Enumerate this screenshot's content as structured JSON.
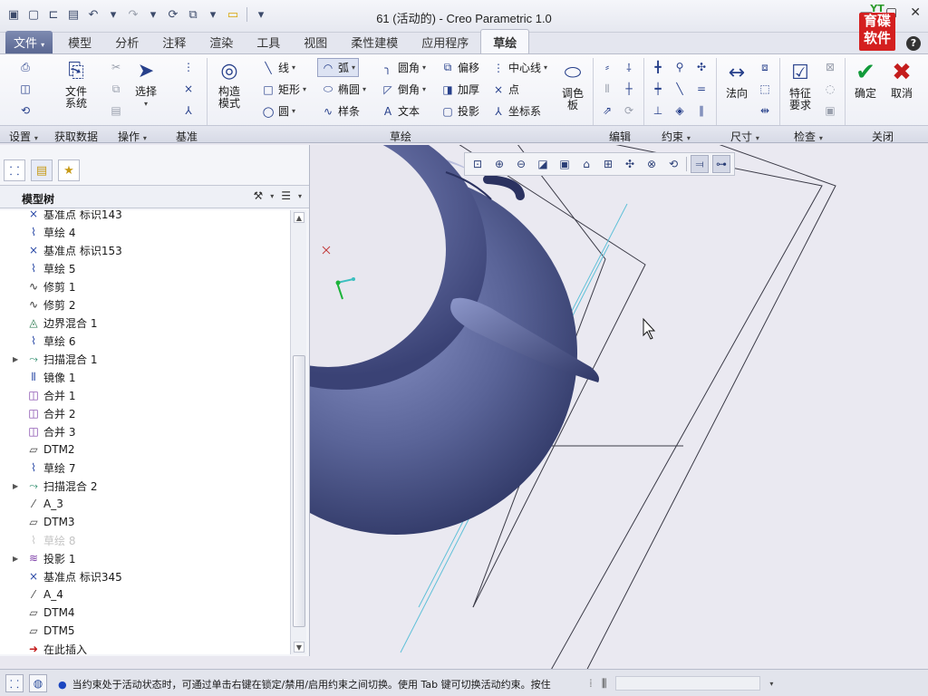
{
  "window": {
    "title": "61 (活动的) - Creo Parametric 1.0"
  },
  "logo": {
    "top": "YT",
    "text": "育碟软件"
  },
  "tabs": [
    "文件",
    "模型",
    "分析",
    "注释",
    "渲染",
    "工具",
    "视图",
    "柔性建模",
    "应用程序",
    "草绘"
  ],
  "active_tab": "草绘",
  "help_label": "?",
  "ribbon": {
    "file_system": "文件\n系统",
    "select": "选择",
    "construct_mode": "构造\n模式",
    "line": "线",
    "arc": "弧",
    "fillet": "圆角",
    "offset": "偏移",
    "centerline": "中心线",
    "rectangle": "矩形",
    "ellipse": "椭圆",
    "chamfer": "倒角",
    "thicken": "加厚",
    "point": "点",
    "circle": "圆",
    "spline": "样条",
    "text": "文本",
    "project": "投影",
    "coord_sys": "坐标系",
    "palette": "调色\n板",
    "normal": "法向",
    "feature_req": "特征\n要求",
    "ok": "确定",
    "cancel": "取消"
  },
  "groups": {
    "setup": "设置",
    "get_data": "获取数据",
    "operations": "操作",
    "datum": "基准",
    "sketch": "草绘",
    "edit": "编辑",
    "constrain": "约束",
    "dimension": "尺寸",
    "inspect": "检查",
    "close": "关闭"
  },
  "model_tree": {
    "title": "模型树",
    "items": [
      {
        "label": "基准点 标识143",
        "icon": "datum-point-icon",
        "expandable": false,
        "dim": false
      },
      {
        "label": "草绘 4",
        "icon": "sketch-icon",
        "expandable": false,
        "dim": false
      },
      {
        "label": "基准点 标识153",
        "icon": "datum-point-icon",
        "expandable": false,
        "dim": false
      },
      {
        "label": "草绘 5",
        "icon": "sketch-icon",
        "expandable": false,
        "dim": false
      },
      {
        "label": "修剪 1",
        "icon": "trim-icon",
        "expandable": false,
        "dim": false
      },
      {
        "label": "修剪 2",
        "icon": "trim-icon",
        "expandable": false,
        "dim": false
      },
      {
        "label": "边界混合 1",
        "icon": "boundary-blend-icon",
        "expandable": false,
        "dim": false
      },
      {
        "label": "草绘 6",
        "icon": "sketch-icon",
        "expandable": false,
        "dim": false
      },
      {
        "label": "扫描混合 1",
        "icon": "swept-blend-icon",
        "expandable": true,
        "dim": false
      },
      {
        "label": "镜像 1",
        "icon": "mirror-icon",
        "expandable": false,
        "dim": false
      },
      {
        "label": "合并 1",
        "icon": "merge-icon",
        "expandable": false,
        "dim": false
      },
      {
        "label": "合并 2",
        "icon": "merge-icon",
        "expandable": false,
        "dim": false
      },
      {
        "label": "合并 3",
        "icon": "merge-icon",
        "expandable": false,
        "dim": false
      },
      {
        "label": "DTM2",
        "icon": "datum-plane-icon",
        "expandable": false,
        "dim": false
      },
      {
        "label": "草绘 7",
        "icon": "sketch-icon",
        "expandable": false,
        "dim": false
      },
      {
        "label": "扫描混合 2",
        "icon": "swept-blend-icon",
        "expandable": true,
        "dim": false
      },
      {
        "label": "A_3",
        "icon": "datum-axis-icon",
        "expandable": false,
        "dim": false
      },
      {
        "label": "DTM3",
        "icon": "datum-plane-icon",
        "expandable": false,
        "dim": false
      },
      {
        "label": "草绘 8",
        "icon": "sketch-icon",
        "expandable": false,
        "dim": true
      },
      {
        "label": "投影 1",
        "icon": "projection-icon",
        "expandable": true,
        "dim": false
      },
      {
        "label": "基准点 标识345",
        "icon": "datum-point-icon",
        "expandable": false,
        "dim": false
      },
      {
        "label": "A_4",
        "icon": "datum-axis-icon",
        "expandable": false,
        "dim": false
      },
      {
        "label": "DTM4",
        "icon": "datum-plane-icon",
        "expandable": false,
        "dim": false
      },
      {
        "label": "DTM5",
        "icon": "datum-plane-icon",
        "expandable": false,
        "dim": false
      },
      {
        "label": "在此插入",
        "icon": "insert-here-icon",
        "expandable": false,
        "dim": false
      }
    ]
  },
  "status": {
    "message": "当约束处于活动状态时，可通过单击右键在锁定/禁用/启用约束之间切换。使用 Tab 键可切换活动约束。按住"
  },
  "colors": {
    "model": "#4e5a8e",
    "viewport_bg": "#eae9f1",
    "accent": "#5a6792"
  }
}
